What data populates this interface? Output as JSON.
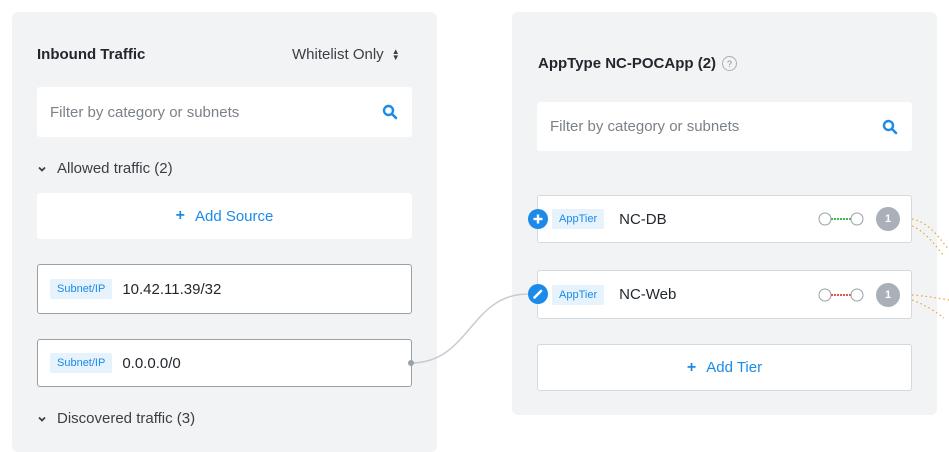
{
  "inbound": {
    "title": "Inbound Traffic",
    "mode": "Whitelist Only",
    "search_placeholder": "Filter by category or subnets",
    "allowed_label": "Allowed traffic (2)",
    "add_source_label": "Add Source",
    "sources": [
      {
        "tag": "Subnet/IP",
        "value": "10.42.11.39/32"
      },
      {
        "tag": "Subnet/IP",
        "value": "0.0.0.0/0"
      }
    ],
    "discovered_label": "Discovered traffic (3)"
  },
  "apptype": {
    "title": "AppType NC-POCApp (2)",
    "help_icon": "?",
    "search_placeholder": "Filter by category or subnets",
    "tiers": [
      {
        "tag": "AppTier",
        "name": "NC-DB",
        "count": "1",
        "link_color": "#3fb94b",
        "action_icon": "plus-icon"
      },
      {
        "tag": "AppTier",
        "name": "NC-Web",
        "count": "1",
        "link_color": "#e0584a",
        "action_icon": "pencil-icon"
      }
    ],
    "add_tier_label": "Add Tier"
  },
  "colors": {
    "accent": "#1b8ae8",
    "panel_bg": "#f2f3f5",
    "connector": "#c8ccd1",
    "outbound_dots": "#f0a030"
  }
}
